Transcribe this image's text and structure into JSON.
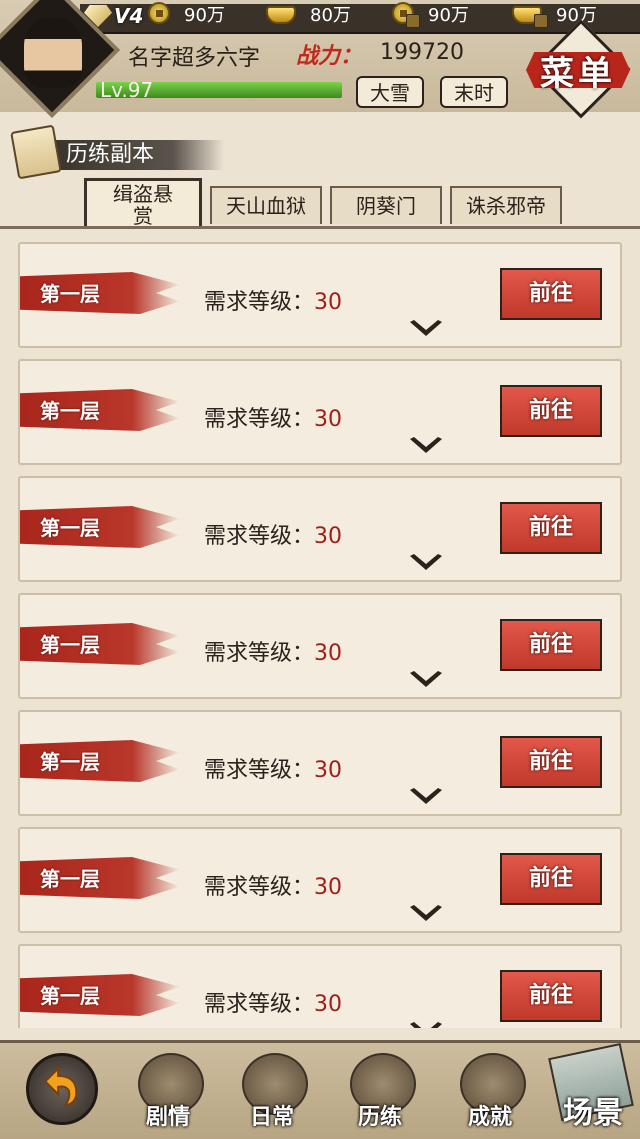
{
  "header": {
    "vip_label": "V4",
    "resources": [
      {
        "icon": "copper-coin-icon",
        "value": "90万"
      },
      {
        "icon": "gold-ingot-icon",
        "value": "80万"
      },
      {
        "icon": "locked-coin-icon",
        "value": "90万"
      },
      {
        "icon": "locked-ingot-icon",
        "value": "90万"
      }
    ],
    "player_name": "名字超多六字",
    "power_label": "战力：",
    "power_value": "199720",
    "level": "Lv.97",
    "xp_fill": 1.0,
    "weather": "大雪",
    "time": "末时",
    "menu_label": "菜单"
  },
  "section": {
    "title": "历练副本"
  },
  "tabs": [
    {
      "label": "缉盗悬赏",
      "active": true
    },
    {
      "label": "天山血狱",
      "active": false
    },
    {
      "label": "阴葵门",
      "active": false
    },
    {
      "label": "诛杀邪帝",
      "active": false
    }
  ],
  "list": {
    "req_label": "需求等级：",
    "go_label": "前往",
    "items": [
      {
        "floor": "第一层",
        "level": "30"
      },
      {
        "floor": "第一层",
        "level": "30"
      },
      {
        "floor": "第一层",
        "level": "30"
      },
      {
        "floor": "第一层",
        "level": "30"
      },
      {
        "floor": "第一层",
        "level": "30"
      },
      {
        "floor": "第一层",
        "level": "30"
      },
      {
        "floor": "第一层",
        "level": "30"
      }
    ]
  },
  "nav": {
    "back_icon": "back-arrow-icon",
    "items": [
      {
        "label": "剧情",
        "icon": "story-icon"
      },
      {
        "label": "日常",
        "icon": "daily-icon"
      },
      {
        "label": "历练",
        "icon": "training-icon"
      },
      {
        "label": "成就",
        "icon": "achievement-icon"
      }
    ],
    "scene_label": "场景"
  }
}
